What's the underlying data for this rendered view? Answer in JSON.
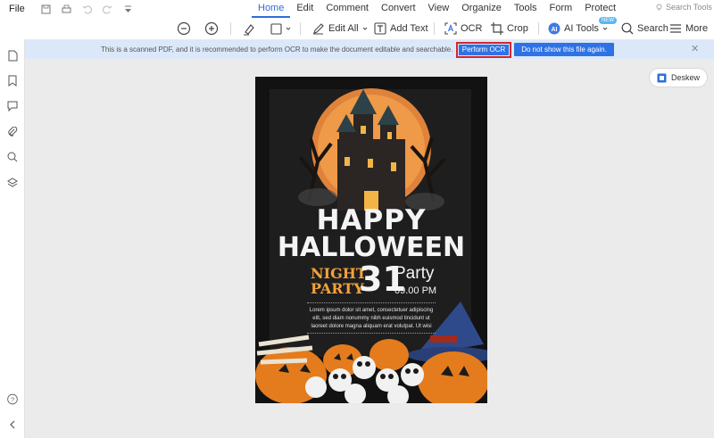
{
  "menubar": {
    "file": "File",
    "menus": [
      "Home",
      "Edit",
      "Comment",
      "Convert",
      "View",
      "Organize",
      "Tools",
      "Form",
      "Protect"
    ],
    "active_menu": "Home",
    "search_tools": "Search Tools"
  },
  "toolbar": {
    "edit_all": "Edit All",
    "add_text": "Add Text",
    "ocr": "OCR",
    "crop": "Crop",
    "ai_tools": "AI Tools",
    "search": "Search",
    "more": "More",
    "new_badge": "NEW"
  },
  "notice": {
    "message": "This is a scanned PDF, and it is recommended to perform OCR to make the document editable and searchable.",
    "perform_ocr": "Perform OCR",
    "dont_show": "Do not show this file again."
  },
  "deskew": {
    "label": "Deskew"
  },
  "poster": {
    "happy": "HAPPY",
    "halloween": "HALLOWEEN",
    "night": "NIGHT",
    "party_left": "PARTY",
    "day": "31",
    "party_right": "Party",
    "time": "09.00 PM",
    "lorem_1": "Lorem ipsum dolor sit amet, consectetuer adipiscing",
    "lorem_2": "elit, sed diam nonummy nibh euismod tincidunt ut",
    "lorem_3": "laoreet dolore magna aliquam erat volutpat. Ut wisi"
  },
  "colors": {
    "accent": "#2f6ed9",
    "notice_bg": "#dbe8fa",
    "highlight": "#d6262c",
    "orange": "#f2a23a"
  },
  "icons": {
    "sidebar": [
      "page-icon",
      "bookmark-icon",
      "comment-icon",
      "attachment-icon",
      "search-icon",
      "layers-icon",
      "help-icon",
      "collapse-icon"
    ]
  }
}
